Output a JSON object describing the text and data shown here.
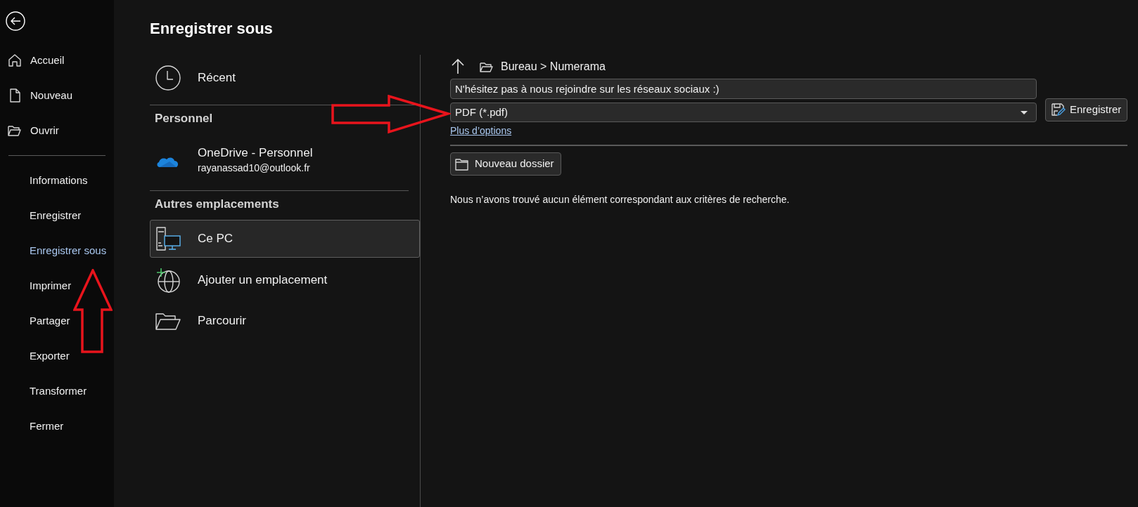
{
  "sidebar": {
    "primary_items": [
      {
        "kind": "home",
        "label": "Accueil",
        "selected": false
      },
      {
        "kind": "new",
        "label": "Nouveau",
        "selected": false
      },
      {
        "kind": "open",
        "label": "Ouvrir",
        "selected": false
      }
    ],
    "secondary_items": [
      {
        "label": "Informations",
        "selected": false
      },
      {
        "label": "Enregistrer",
        "selected": false
      },
      {
        "label": "Enregistrer sous",
        "selected": true
      },
      {
        "label": "Imprimer",
        "selected": false
      },
      {
        "label": "Partager",
        "selected": false
      },
      {
        "label": "Exporter",
        "selected": false
      },
      {
        "label": "Transformer",
        "selected": false
      },
      {
        "label": "Fermer",
        "selected": false
      }
    ]
  },
  "page_title": "Enregistrer sous",
  "recent": {
    "label": "Récent",
    "selected": false
  },
  "groups": [
    {
      "heading": "Personnel",
      "items": [
        {
          "kind": "onedrive",
          "label": "OneDrive - Personnel",
          "detail": "rayanassad10@outlook.fr",
          "selected": false
        }
      ]
    },
    {
      "heading": "Autres emplacements",
      "items": [
        {
          "kind": "pc",
          "label": "Ce PC",
          "selected": true
        },
        {
          "kind": "add",
          "label": "Ajouter un emplacement",
          "selected": false
        },
        {
          "kind": "browse",
          "label": "Parcourir",
          "selected": false
        }
      ]
    }
  ],
  "path": "Bureau > Numerama",
  "file_name": "N'hésitez pas à nous rejoindre sur les réseaux sociaux :)",
  "file_type": "PDF (*.pdf)",
  "save_button": "Enregistrer",
  "more_options": "Plus d’options",
  "new_folder_button": "Nouveau dossier",
  "empty_message": "Nous n’avons trouvé aucun élément correspondant aux critères de recherche."
}
